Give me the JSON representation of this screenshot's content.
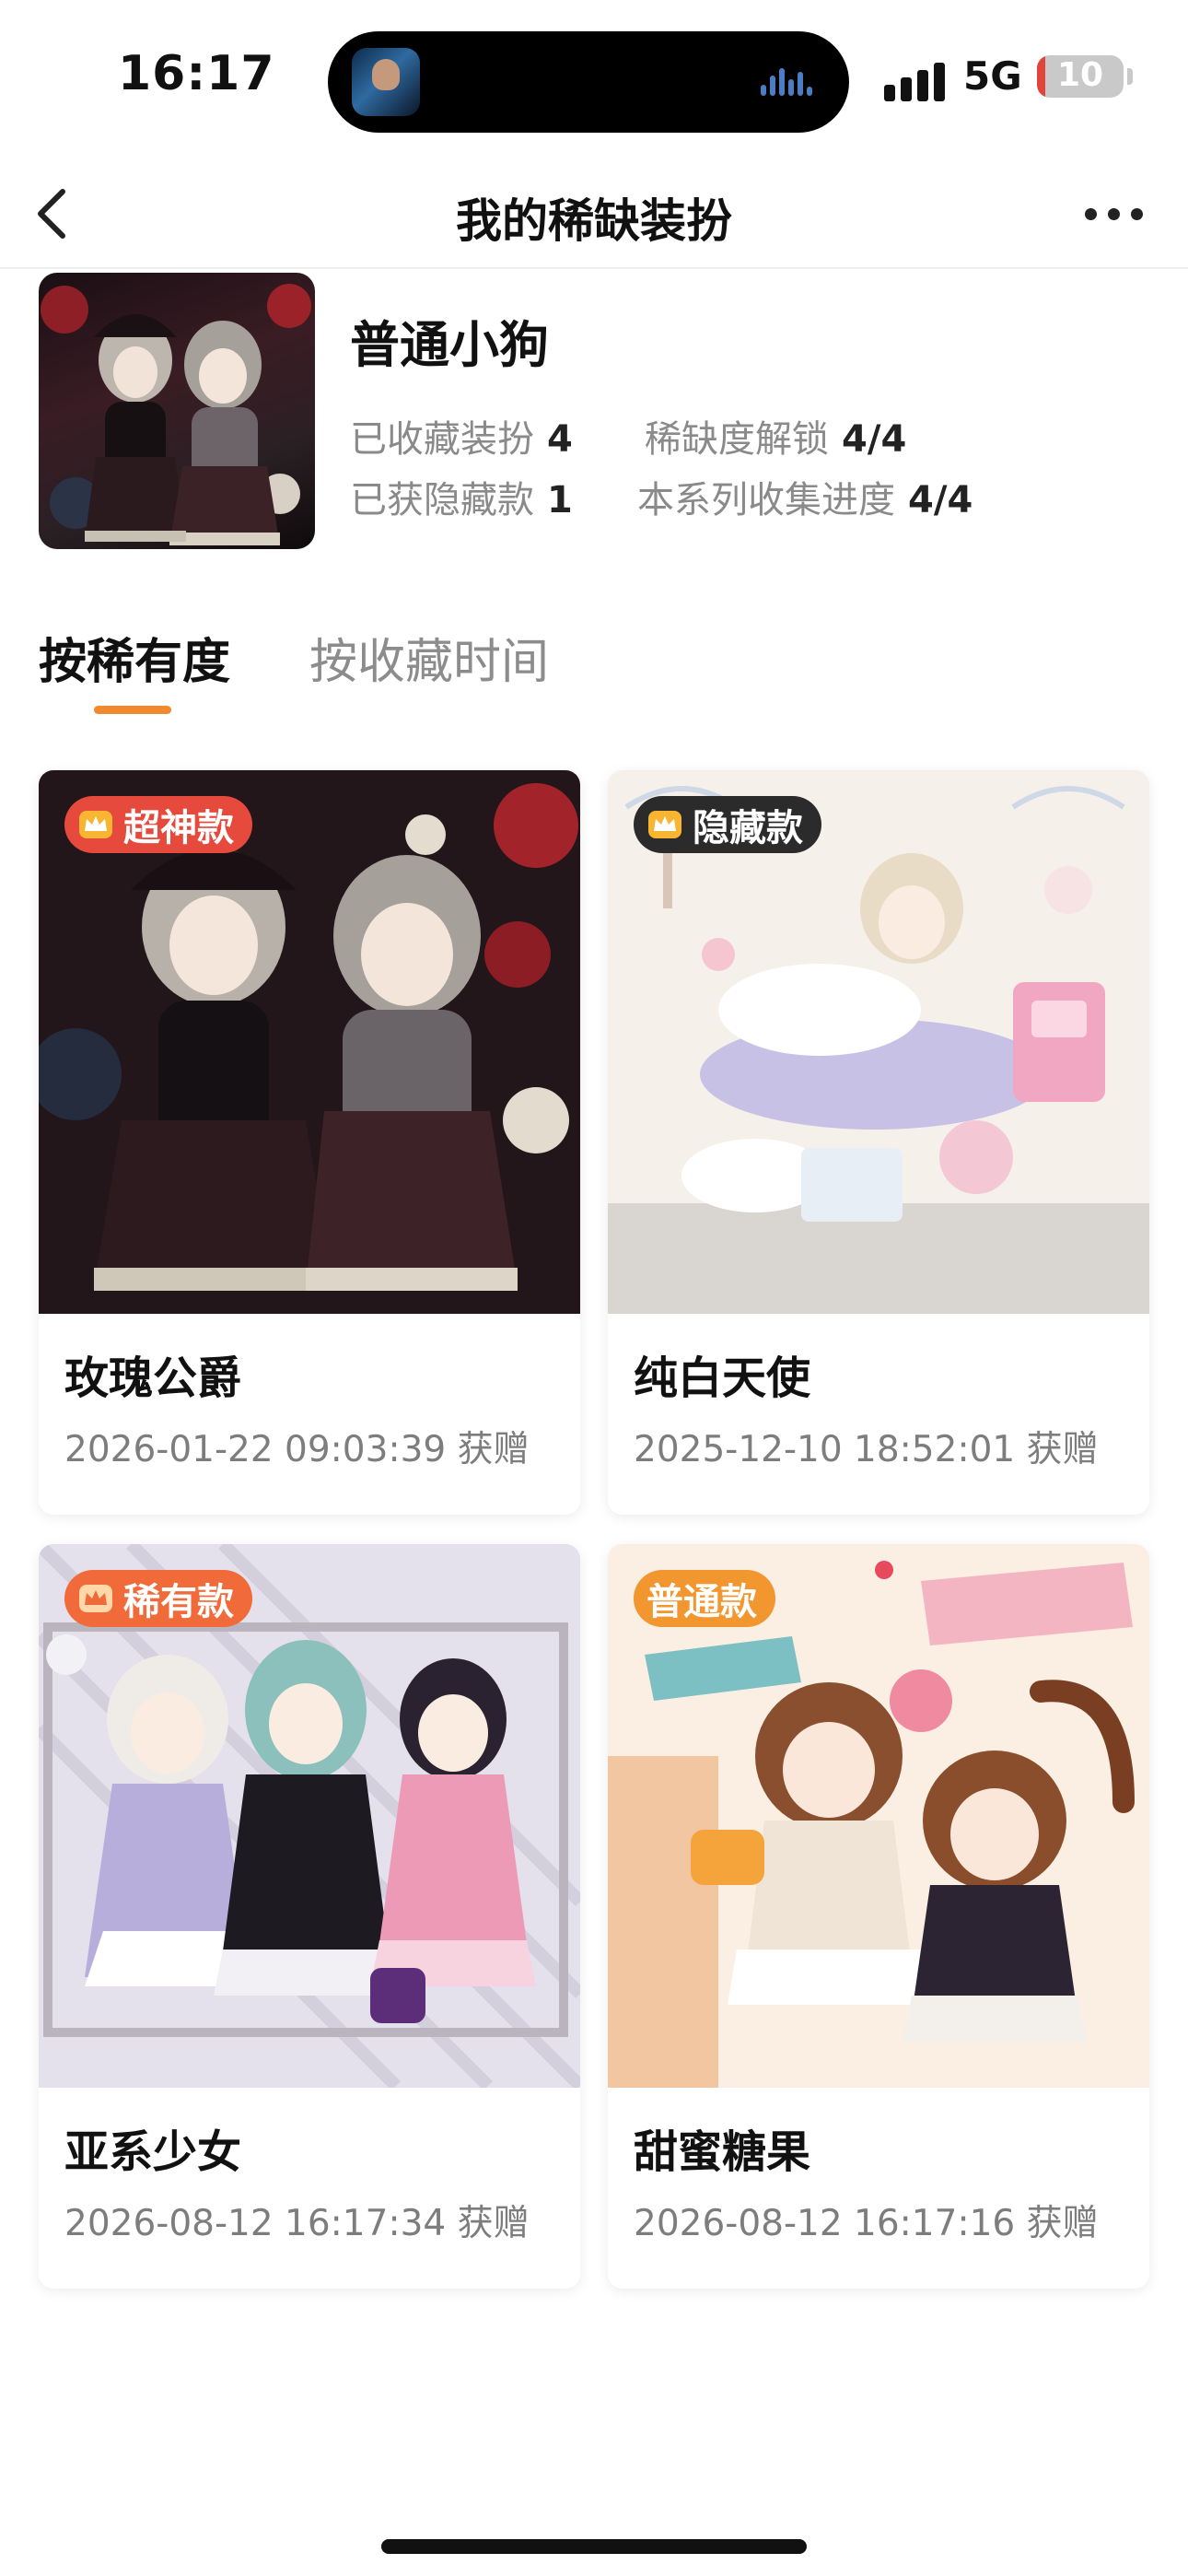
{
  "status_bar": {
    "time": "16:17",
    "network": "5G",
    "battery": "10",
    "battery_level_percent": 10,
    "battery_color": "#e0443a"
  },
  "nav": {
    "title": "我的稀缺装扮",
    "back_icon": "chevron-left-icon",
    "more_icon": "more-dots-icon"
  },
  "series": {
    "name": "普通小狗",
    "collected_label": "已收藏装扮",
    "collected_value": "4",
    "unlock_label": "稀缺度解锁",
    "unlock_value": "4/4",
    "hidden_label": "已获隐藏款",
    "hidden_value": "1",
    "progress_label": "本系列收集进度",
    "progress_value": "4/4"
  },
  "sort_tabs": [
    {
      "label": "按稀有度",
      "active": true
    },
    {
      "label": "按收藏时间",
      "active": false
    }
  ],
  "accent_color": "#f08a2e",
  "items": [
    {
      "badge": "超神款",
      "badge_icon": "crown-icon",
      "badge_color": "#e64a3c",
      "name": "玫瑰公爵",
      "time": "2026-01-22 09:03:39 获赠"
    },
    {
      "badge": "隐藏款",
      "badge_icon": "crown-icon",
      "badge_color": "#2b2b2b",
      "name": "纯白天使",
      "time": "2025-12-10 18:52:01 获赠"
    },
    {
      "badge": "稀有款",
      "badge_icon": "crown-icon",
      "badge_color": "#f06a3a",
      "name": "亚系少女",
      "time": "2026-08-12 16:17:34 获赠"
    },
    {
      "badge": "普通款",
      "badge_icon": "",
      "badge_color": "#f2962f",
      "name": "甜蜜糖果",
      "time": "2026-08-12 16:17:16 获赠"
    }
  ]
}
